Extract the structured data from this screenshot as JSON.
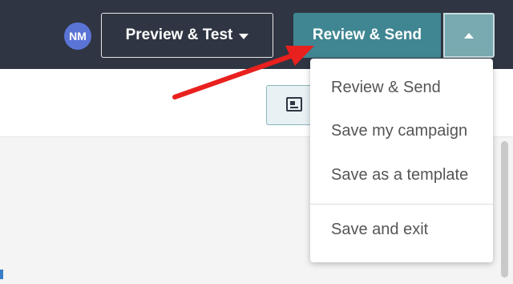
{
  "header": {
    "avatar_initials": "NM",
    "preview_test_label": "Preview & Test",
    "review_send_label": "Review & Send"
  },
  "dropdown": {
    "items": [
      {
        "label": "Review & Send"
      },
      {
        "label": "Save my campaign"
      },
      {
        "label": "Save as a template"
      },
      {
        "label": "Save and exit"
      }
    ]
  },
  "icons": {
    "preview_caret": "caret-down-icon",
    "toggle_caret": "caret-up-icon",
    "layout": "layout-icon"
  },
  "colors": {
    "topbar": "#2f3542",
    "primary_button": "#3f8692",
    "toggle_button": "#7aaab1",
    "avatar": "#5a74d6",
    "annotation_arrow": "#e8201e"
  }
}
